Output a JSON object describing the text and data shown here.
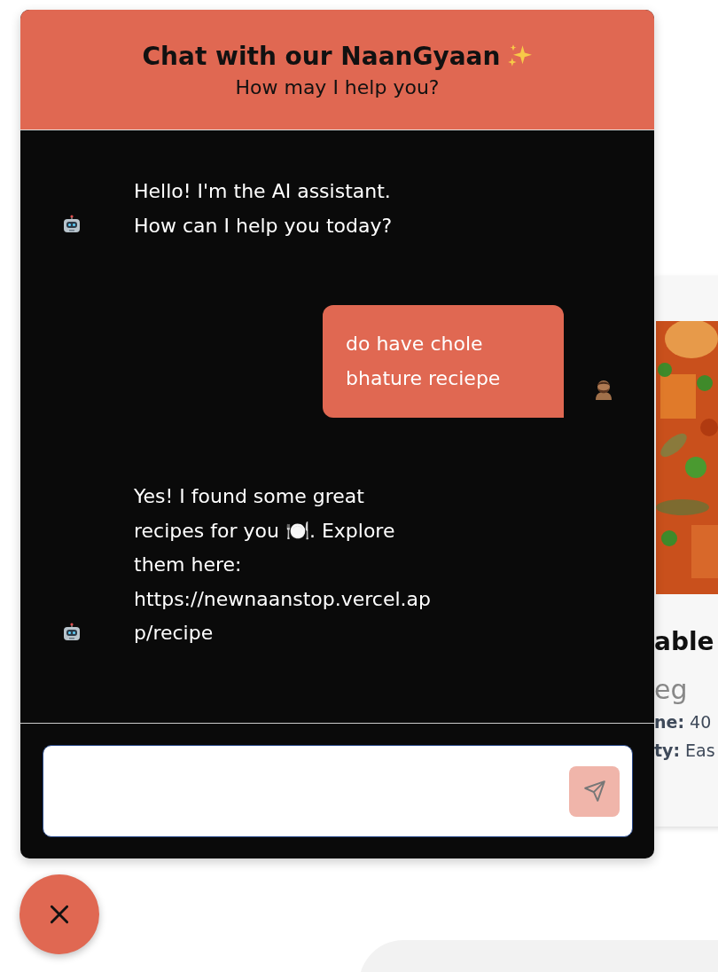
{
  "chat": {
    "title": "Chat with our NaanGyaan",
    "subtitle": "How may I help you?",
    "messages": [
      {
        "kind": "bot",
        "text": "Hello! I'm the AI assistant. How can I help you today?"
      },
      {
        "kind": "user",
        "text": "do have chole bhature reciepe"
      },
      {
        "kind": "bot",
        "text": "Yes! I found some great recipes for you 🍽️. Explore them here: https://newnaanstop.vercel.app/recipe"
      }
    ]
  },
  "recipe_card": {
    "title": "able",
    "category": "eg",
    "details": [
      "**ne:** 40",
      "**ty:** Eas"
    ]
  }
}
